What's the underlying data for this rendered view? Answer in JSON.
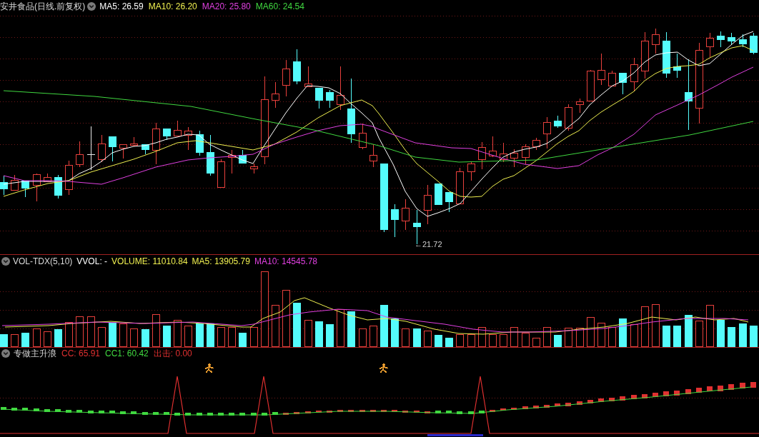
{
  "price_panel": {
    "title": "安井食品(日线.前复权)",
    "indicators": [
      {
        "label": "MA5: 26.59",
        "color": "#ffffff"
      },
      {
        "label": "MA10: 26.20",
        "color": "#f0f050"
      },
      {
        "label": "MA20: 25.80",
        "color": "#e040e0"
      },
      {
        "label": "MA60: 24.54",
        "color": "#40d840"
      }
    ],
    "low_marker": "←21.72"
  },
  "volume_panel": {
    "title": "VOL-TDX(5,10)",
    "indicators": [
      {
        "label": "VVOL: -",
        "color": "#ffffff"
      },
      {
        "label": "VOLUME: 11010.84",
        "color": "#f0f050"
      },
      {
        "label": "MA5: 13905.79",
        "color": "#f0f050"
      },
      {
        "label": "MA10: 14545.78",
        "color": "#e040e0"
      }
    ]
  },
  "indicator_panel": {
    "title": "专做主升浪",
    "indicators": [
      {
        "label": "CC: 65.91",
        "color": "#e03030"
      },
      {
        "label": "CC1: 60.42",
        "color": "#40d840"
      },
      {
        "label": "出击: 0.00",
        "color": "#e03030"
      }
    ]
  }
}
